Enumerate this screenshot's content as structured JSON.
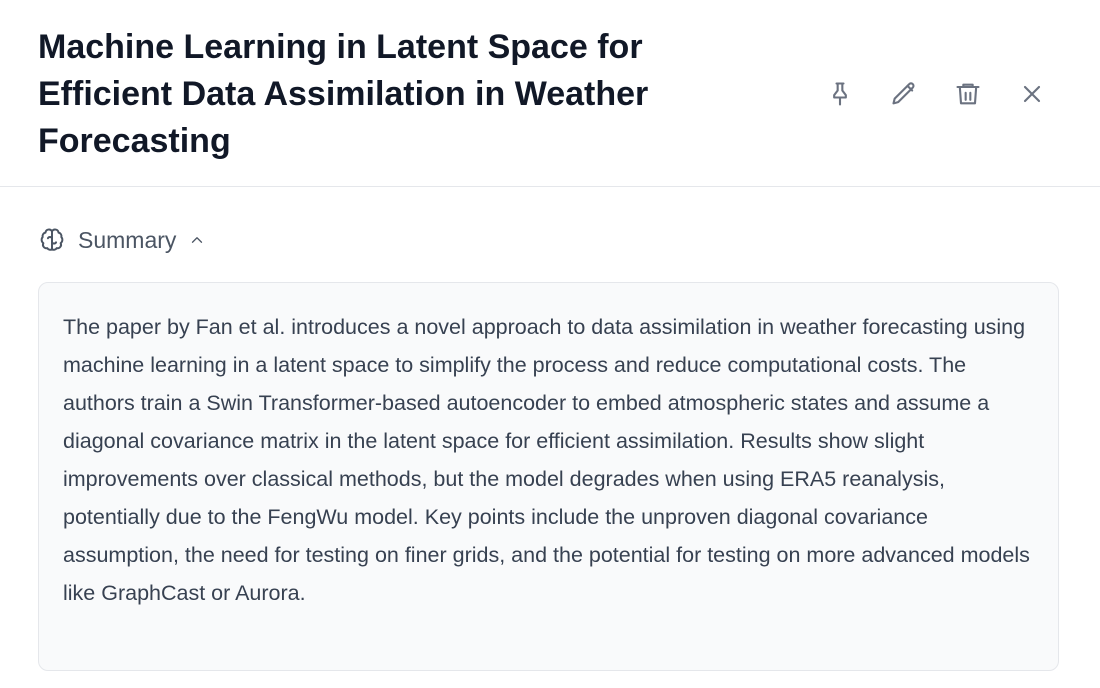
{
  "header": {
    "title": "Machine Learning in Latent Space for Efficient Data Assimilation in Weather Forecasting",
    "actions": [
      {
        "name": "pin",
        "icon": "pin-icon"
      },
      {
        "name": "edit",
        "icon": "pencil-icon"
      },
      {
        "name": "delete",
        "icon": "trash-icon"
      },
      {
        "name": "close",
        "icon": "close-icon"
      }
    ]
  },
  "summary": {
    "label": "Summary",
    "icon": "brain-icon",
    "expanded": true,
    "text": "The paper by Fan et al. introduces a novel approach to data assimilation in weather forecasting using machine learning in a latent space to simplify the process and reduce computational costs. The authors train a Swin Transformer-based autoencoder to embed atmospheric states and assume a diagonal covariance matrix in the latent space for efficient assimilation. Results show slight improvements over classical methods, but the model degrades when using ERA5 reanalysis, potentially due to the FengWu model. Key points include the unproven diagonal covariance assumption, the need for testing on finer grids, and the potential for testing on more advanced models like GraphCast or Aurora."
  },
  "colors": {
    "title": "#111827",
    "icon": "#6b7280",
    "summary_bg": "#f9fafb",
    "summary_border": "#e5e7eb",
    "body_text": "#374151"
  }
}
